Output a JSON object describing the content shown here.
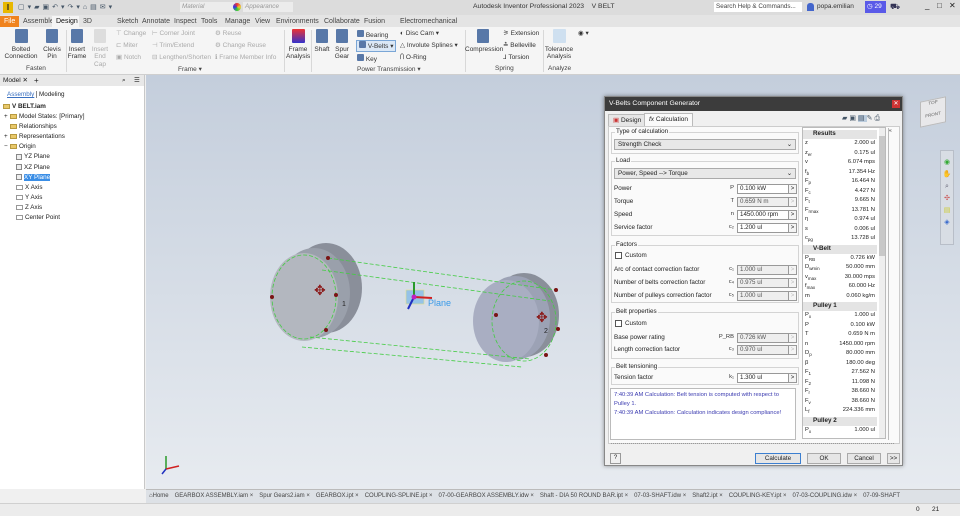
{
  "app": {
    "title": "Autodesk Inventor Professional 2023    V BELT",
    "material_placeholder": "Material",
    "appearance_placeholder": "Appearance",
    "search_placeholder": "Search Help & Commands...",
    "user": "popa.emilian",
    "trial_days": "29"
  },
  "ribbon_tabs": [
    "File",
    "Assemble",
    "Design",
    "3D Model",
    "Sketch",
    "Annotate",
    "Inspect",
    "Tools",
    "Manage",
    "View",
    "Environments",
    "Collaborate",
    "Fusion 360",
    "Electromechanical"
  ],
  "active_tab": "Design",
  "ribbon": {
    "fasten": {
      "label": "Fasten",
      "bolted": "Bolted Connection",
      "clevis": "Clevis Pin"
    },
    "frame": {
      "label": "Frame ▾",
      "insert_frame": "Insert Frame",
      "insert_end_cap": "Insert End Cap",
      "change": "Change",
      "miter": "Miter",
      "notch": "Notch",
      "corner_joint": "Corner Joint",
      "trim_extend": "Trim/Extend",
      "lengthen": "Lengthen/Shorten",
      "reuse": "Reuse",
      "change_reuse": "Change Reuse",
      "member_info": "Frame Member Info",
      "analysis": "Frame Analysis"
    },
    "power": {
      "label": "Power Transmission ▾",
      "shaft": "Shaft",
      "spur": "Spur Gear",
      "bearing": "Bearing",
      "vbelts": "V-Belts",
      "key": "Key",
      "disc_cam": "Disc Cam",
      "involute": "Involute Splines",
      "oring": "O-Ring"
    },
    "spring": {
      "label": "Spring",
      "compression": "Compression",
      "extension": "Extension",
      "belleville": "Belleville",
      "torsion": "Torsion"
    },
    "analyze": {
      "label": "Analyze",
      "tolerance": "Tolerance Analysis"
    }
  },
  "browser": {
    "tab": "Model",
    "sub_tabs": [
      "Assembly",
      "Modeling"
    ],
    "tree": [
      {
        "t": "V BELT.iam",
        "lvl": 0,
        "k": "asm"
      },
      {
        "t": "Model States: [Primary]",
        "lvl": 1,
        "k": "fold",
        "exp": "+"
      },
      {
        "t": "Relationships",
        "lvl": 1,
        "k": "fold"
      },
      {
        "t": "Representations",
        "lvl": 1,
        "k": "fold",
        "exp": "+"
      },
      {
        "t": "Origin",
        "lvl": 1,
        "k": "fold",
        "exp": "−"
      },
      {
        "t": "YZ Plane",
        "lvl": 2,
        "k": "pl"
      },
      {
        "t": "XZ Plane",
        "lvl": 2,
        "k": "pl"
      },
      {
        "t": "XY Plane",
        "lvl": 2,
        "k": "pl",
        "sel": true
      },
      {
        "t": "X Axis",
        "lvl": 2,
        "k": "ax"
      },
      {
        "t": "Y Axis",
        "lvl": 2,
        "k": "ax"
      },
      {
        "t": "Z Axis",
        "lvl": 2,
        "k": "ax"
      },
      {
        "t": "Center Point",
        "lvl": 2,
        "k": "pt"
      }
    ]
  },
  "viewport": {
    "plane_label": "Plane",
    "pulley1": "1",
    "pulley2": "2",
    "viewcube_top": "TOP",
    "viewcube_front": "FRONT"
  },
  "dialog": {
    "title": "V-Belts Component Generator",
    "tabs": [
      "Design",
      "Calculation"
    ],
    "type_of_calc_label": "Type of calculation",
    "type_of_calc": "Strength Check",
    "load_label": "Load",
    "load_mode": "Power, Speed --> Torque",
    "load_rows": [
      {
        "l": "Power",
        "s": "P",
        "v": "0.100 kW"
      },
      {
        "l": "Torque",
        "s": "T",
        "v": "0.659 N m",
        "ro": true
      },
      {
        "l": "Speed",
        "s": "n",
        "v": "1450.000 rpm"
      },
      {
        "l": "Service factor",
        "s": "c₂",
        "v": "1.200 ul"
      }
    ],
    "factors_label": "Factors",
    "custom": "Custom",
    "factor_rows": [
      {
        "l": "Arc of contact correction factor",
        "s": "c₁",
        "v": "1.000 ul",
        "ro": true
      },
      {
        "l": "Number of belts correction factor",
        "s": "c₄",
        "v": "0.975 ul",
        "ro": true
      },
      {
        "l": "Number of pulleys correction factor",
        "s": "c₅",
        "v": "1.000 ul",
        "ro": true
      }
    ],
    "belt_label": "Belt properties",
    "belt_rows": [
      {
        "l": "Base power rating",
        "s": "P_RB",
        "v": "0.726 kW",
        "ro": true
      },
      {
        "l": "Length correction factor",
        "s": "c₃",
        "v": "0.970 ul",
        "ro": true
      }
    ],
    "tension_label": "Belt tensioning",
    "tension_rows": [
      {
        "l": "Tension factor",
        "s": "k₁",
        "v": "1.300 ul"
      }
    ],
    "messages": [
      "7:40:39 AM Calculation: Belt tension is computed with respect to Pulley 1.",
      "7:40:39 AM Calculation: Calculation indicates design compliance!"
    ],
    "results": [
      {
        "h": "Results"
      },
      {
        "s": "z",
        "v": "2.000 ul"
      },
      {
        "s": "z",
        "b": "er",
        "v": "0.175 ul"
      },
      {
        "s": "v",
        "v": "6.074 mps"
      },
      {
        "s": "f",
        "b": "b",
        "v": "17.354 Hz"
      },
      {
        "s": "F",
        "b": "p",
        "v": "16.464 N"
      },
      {
        "s": "F",
        "b": "c",
        "v": "4.427 N"
      },
      {
        "s": "F",
        "b": "t",
        "v": "9.665 N"
      },
      {
        "s": "F",
        "b": "rmax",
        "v": "13.781 N"
      },
      {
        "s": "η",
        "v": "0.974 ul"
      },
      {
        "s": "s",
        "v": "0.006 ul"
      },
      {
        "s": "c",
        "b": "pg",
        "v": "13.728 ul"
      },
      {
        "h": "V-Belt"
      },
      {
        "s": "P",
        "b": "RB",
        "v": "0.726 kW"
      },
      {
        "s": "D",
        "b": "wmin",
        "v": "50.000 mm"
      },
      {
        "s": "v",
        "b": "max",
        "v": "30.000 mps"
      },
      {
        "s": "f",
        "b": "max",
        "v": "60.000 Hz"
      },
      {
        "s": "m",
        "v": "0.060 kg/m"
      },
      {
        "h": "Pulley 1"
      },
      {
        "s": "P",
        "b": "x",
        "v": "1.000 ul"
      },
      {
        "s": "P",
        "v": "0.100 kW"
      },
      {
        "s": "T",
        "v": "0.659 N m"
      },
      {
        "s": "n",
        "v": "1450.000 rpm"
      },
      {
        "s": "D",
        "b": "p",
        "v": "80.000 mm"
      },
      {
        "s": "β",
        "v": "180.00 deg"
      },
      {
        "s": "F",
        "b": "1",
        "v": "27.562 N"
      },
      {
        "s": "F",
        "b": "2",
        "v": "11.098 N"
      },
      {
        "s": "F",
        "b": "r",
        "v": "38.660 N"
      },
      {
        "s": "F",
        "b": "v",
        "v": "38.660 N"
      },
      {
        "s": "L",
        "b": "f",
        "v": "224.336 mm"
      },
      {
        "h": "Pulley 2"
      },
      {
        "s": "P",
        "b": "x",
        "v": "1.000 ul"
      }
    ],
    "buttons": {
      "calculate": "Calculate",
      "ok": "OK",
      "cancel": "Cancel",
      "more": ">>"
    }
  },
  "doc_tabs": [
    "Home",
    "GEARBOX ASSEMBLY.iam",
    "Spur Gears2.iam",
    "GEARBOX.ipt",
    "COUPLING-SPLINE.ipt",
    "07-00-GEARBOX ASSEMBLY.idw",
    "Shaft - DIA 50 ROUND BAR.ipt",
    "07-03-SHAFT.idw",
    "Shaft2.ipt",
    "COUPLING-KEY.ipt",
    "07-03-COUPLING.idw",
    "07-09-SHAFT"
  ],
  "status": {
    "count1": "0",
    "count2": "21"
  },
  "colors": {
    "file_tab": "#f0831e",
    "dialog_title": "#3c3c3c",
    "message_text": "#3a3ab0",
    "belt": "#44cc44",
    "trial_badge": "#5a5ae8"
  }
}
